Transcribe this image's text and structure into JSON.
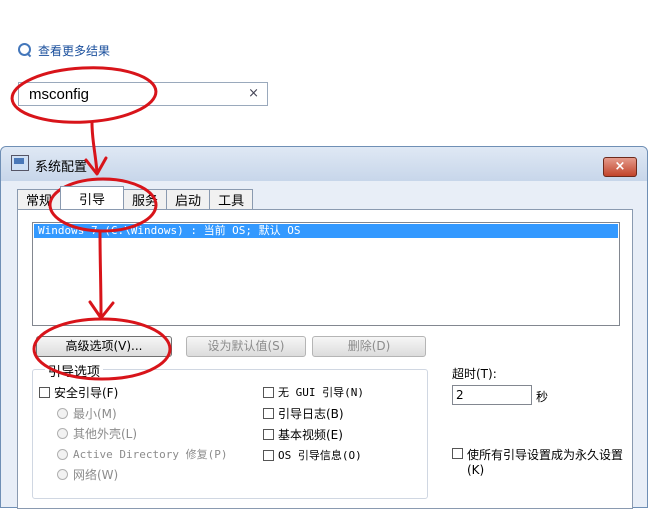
{
  "search": {
    "more_results": "查看更多结果",
    "query": "msconfig",
    "clear": "×"
  },
  "dialog": {
    "title": "系统配置",
    "close": "×",
    "tabs": [
      "常规",
      "引导",
      "服务",
      "启动",
      "工具"
    ],
    "os_entry": "Windows 7 (C:\\Windows) : 当前 OS; 默认 OS",
    "buttons": {
      "advanced": "高级选项(V)...",
      "set_default": "设为默认值(S)",
      "delete": "删除(D)"
    },
    "boot_options": {
      "title": "引导选项",
      "safe_boot": "安全引导(F)",
      "minimal": "最小(M)",
      "alternate_shell": "其他外壳(L)",
      "active_directory": "Active Directory 修复(P)",
      "network": "网络(W)",
      "no_gui": "无 GUI 引导(N)",
      "boot_log": "引导日志(B)",
      "base_video": "基本视频(E)",
      "os_boot_info": "OS 引导信息(O)"
    },
    "timeout": {
      "label": "超时(T):",
      "value": "2",
      "unit": "秒"
    },
    "make_permanent": "使所有引导设置成为永久设置(K)"
  },
  "colors": {
    "annotation": "#d8141a",
    "selection": "#3399ff"
  }
}
